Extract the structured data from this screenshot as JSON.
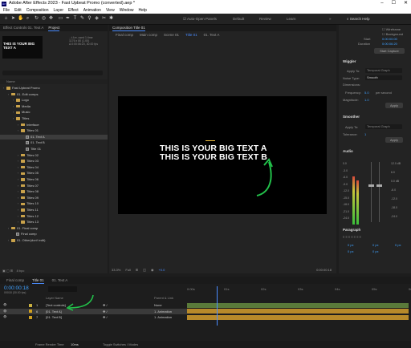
{
  "window": {
    "title": "Adobe After Effects 2023 - Fast Upbeat Promo (converted).aep *",
    "app_badge": "Ae"
  },
  "menu": [
    "File",
    "Edit",
    "Composition",
    "Layer",
    "Effect",
    "Animation",
    "View",
    "Window",
    "Help"
  ],
  "toolbar": {
    "auto_open": "Auto-Open Panels",
    "workspaces": [
      "Default",
      "Review",
      "Learn"
    ],
    "search_placeholder": "Search Help"
  },
  "left_panel": {
    "tabs": [
      "Effect Controls 01. Text A",
      "Project"
    ],
    "thumb_text": "THIS IS YOUR BIG TEXT A",
    "info": [
      "...t A ▾, used 1 time",
      "1176 x 80 (1.00)",
      "Δ 0:00:06:20, 30.00 fps"
    ],
    "columns": "Name",
    "tree": [
      {
        "label": "Fast Upbeat Promo",
        "indent": 0,
        "type": "folder"
      },
      {
        "label": "01. Edit comps",
        "indent": 1,
        "type": "folder"
      },
      {
        "label": "Logo",
        "indent": 2,
        "type": "folder"
      },
      {
        "label": "Media",
        "indent": 2,
        "type": "folder"
      },
      {
        "label": "Music",
        "indent": 2,
        "type": "folder"
      },
      {
        "label": "Titles",
        "indent": 2,
        "type": "folder"
      },
      {
        "label": "Interface",
        "indent": 3,
        "type": "folder"
      },
      {
        "label": "Titles 01",
        "indent": 3,
        "type": "folder"
      },
      {
        "label": "01. Text A",
        "indent": 4,
        "type": "comp"
      },
      {
        "label": "01. Text B",
        "indent": 4,
        "type": "comp"
      },
      {
        "label": "Title 01",
        "indent": 4,
        "type": "comp"
      },
      {
        "label": "Titles 02",
        "indent": 3,
        "type": "folder"
      },
      {
        "label": "Titles 03",
        "indent": 3,
        "type": "folder"
      },
      {
        "label": "Titles 04",
        "indent": 3,
        "type": "folder"
      },
      {
        "label": "Titles 05",
        "indent": 3,
        "type": "folder"
      },
      {
        "label": "Titles 06",
        "indent": 3,
        "type": "folder"
      },
      {
        "label": "Titles 07",
        "indent": 3,
        "type": "folder"
      },
      {
        "label": "Titles 08",
        "indent": 3,
        "type": "folder"
      },
      {
        "label": "Titles 09",
        "indent": 3,
        "type": "folder"
      },
      {
        "label": "Titles 10",
        "indent": 3,
        "type": "folder"
      },
      {
        "label": "Titles 11",
        "indent": 3,
        "type": "folder"
      },
      {
        "label": "Titles 12",
        "indent": 3,
        "type": "folder"
      },
      {
        "label": "Titles 13",
        "indent": 3,
        "type": "folder"
      },
      {
        "label": "01. Final comp",
        "indent": 1,
        "type": "folder"
      },
      {
        "label": "Final comp",
        "indent": 2,
        "type": "comp"
      },
      {
        "label": "01. Other(don't edit)",
        "indent": 1,
        "type": "folder"
      }
    ],
    "selected_index": 8,
    "footer": "8 bpc"
  },
  "comp_panel": {
    "header": "Composition Title 01",
    "breadcrumbs": [
      "Final comp",
      "Main comp",
      "Scene 01",
      "Title 01",
      "01. Text A"
    ],
    "line_a": "THIS IS YOUR BIG TEXT A",
    "line_b": "THIS IS YOUR BIG TEXT B",
    "zoom": "33.3%",
    "resolution": "Full",
    "timecode": "0:00:00:18",
    "exposure": "+0.0"
  },
  "right_panel": {
    "preview_opts": [
      "Wireframe",
      "Background"
    ],
    "start_label": "Start",
    "start": "0:00:00:00",
    "duration_label": "Duration",
    "duration": "0:00:06:20",
    "start_capture": "Start Capture",
    "wiggler": {
      "title": "Wiggler",
      "apply_to": "Apply To:",
      "apply_value": "Temporal Graph",
      "noise": "Noise Type:",
      "noise_value": "Smooth",
      "dimensions": "Dimensions:",
      "frequency": "Frequency:",
      "frequency_value": "5.0",
      "freq_unit": "per second",
      "magnitude": "Magnitude:",
      "magnitude_value": "1.0",
      "apply": "Apply"
    },
    "smoother": {
      "title": "Smoother",
      "apply_to": "Apply To:",
      "apply_value": "Temporal Graph",
      "tolerance": "Tolerance:",
      "tolerance_value": "1",
      "apply": "Apply"
    },
    "audio": {
      "title": "Audio",
      "left_scale": [
        "0.0",
        "-3.0",
        "-6.0",
        "-9.0",
        "-12.0",
        "-15.0",
        "-18.0",
        "-21.0",
        "-24.0"
      ],
      "right_scale": [
        "12.0 dB",
        "6.0",
        "0.0 dB",
        "-6.0",
        "-12.0",
        "-18.0",
        "-24.0"
      ]
    },
    "paragraph": {
      "title": "Paragraph",
      "fields": [
        "0 px",
        "0 px",
        "0 px",
        "0 px",
        "0 px"
      ]
    }
  },
  "timeline": {
    "tabs": [
      "Final comp",
      "Title 01",
      "01. Text A"
    ],
    "timecode": "0:00:00:18",
    "timecode_sub": "00018 (30.00 fps)",
    "col_layer": "Layer Name",
    "col_parent": "Parent & Link",
    "ruler": [
      "0:00s",
      "01s",
      "02s",
      "03s",
      "04s",
      "05s",
      "06s"
    ],
    "layers": [
      {
        "num": "1",
        "name": "[Text controls]",
        "parent": "None",
        "color": "#c9b040"
      },
      {
        "num": "6",
        "name": "[01. Text A]",
        "parent": "1. Animation",
        "color": "#d0a020",
        "selected": true
      },
      {
        "num": "7",
        "name": "[01. Text B]",
        "parent": "1. Animation",
        "color": "#d0a020"
      }
    ],
    "frame_render": "Frame Render Time",
    "frame_render_value": "10ms",
    "toggle": "Toggle Switches / Modes"
  },
  "colors": {
    "accent_blue": "#4a8cff",
    "annotation_green": "#22c04a",
    "track_green": "#5a7a3a",
    "track_gold": "#b88a2a"
  }
}
